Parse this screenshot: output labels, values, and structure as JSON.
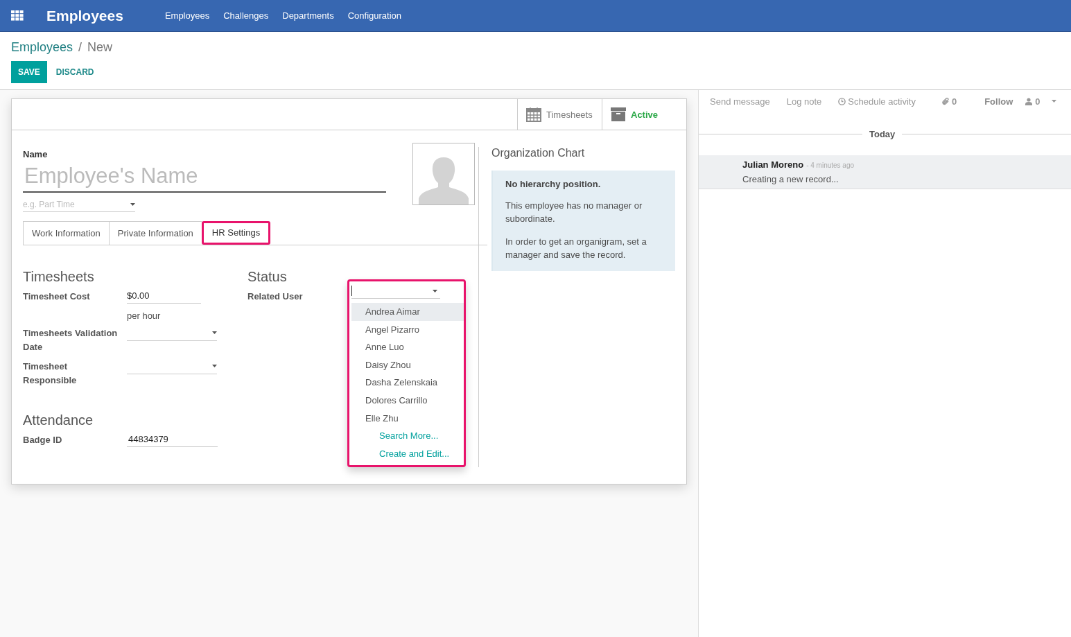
{
  "nav": {
    "app_title": "Employees",
    "menu": [
      "Employees",
      "Challenges",
      "Departments",
      "Configuration"
    ]
  },
  "breadcrumb": {
    "parent": "Employees",
    "separator": "/",
    "current": "New"
  },
  "buttons": {
    "save": "SAVE",
    "discard": "DISCARD"
  },
  "stat_buttons": [
    {
      "kind": "calendar",
      "label": "Timesheets",
      "active": false
    },
    {
      "kind": "archive",
      "label": "Active",
      "active": true
    }
  ],
  "form": {
    "name_label": "Name",
    "name_placeholder": "Employee's Name",
    "job_placeholder": "e.g. Part Time",
    "tabs": [
      {
        "label": "Work Information",
        "selected": false,
        "highlighted": false
      },
      {
        "label": "Private Information",
        "selected": false,
        "highlighted": false
      },
      {
        "label": "HR Settings",
        "selected": true,
        "highlighted": true
      }
    ],
    "timesheets": {
      "title": "Timesheets",
      "fields": [
        {
          "label": "Timesheet Cost",
          "kind": "input",
          "value": "$0.00",
          "note": "per hour"
        },
        {
          "label": "Timesheets Validation Date",
          "kind": "select"
        },
        {
          "label": "Timesheet Responsible",
          "kind": "select"
        }
      ]
    },
    "attendance": {
      "title": "Attendance",
      "fields": [
        {
          "label": "Badge ID",
          "kind": "input",
          "value": "44834379"
        }
      ]
    },
    "status": {
      "title": "Status",
      "related_user": {
        "label": "Related User",
        "highlighted": true,
        "options": [
          {
            "label": "Andrea Aimar",
            "kind": "option",
            "selected": true
          },
          {
            "label": "Angel Pizarro",
            "kind": "option",
            "selected": false
          },
          {
            "label": "Anne Luo",
            "kind": "option",
            "selected": false
          },
          {
            "label": "Daisy Zhou",
            "kind": "option",
            "selected": false
          },
          {
            "label": "Dasha Zelenskaia",
            "kind": "option",
            "selected": false
          },
          {
            "label": "Dolores Carrillo",
            "kind": "option",
            "selected": false
          },
          {
            "label": "Elle Zhu",
            "kind": "option",
            "selected": false
          },
          {
            "label": "Search More...",
            "kind": "action",
            "selected": false
          },
          {
            "label": "Create and Edit...",
            "kind": "action",
            "selected": false
          }
        ]
      }
    }
  },
  "org_chart": {
    "title": "Organization Chart",
    "heading": "No hierarchy position.",
    "paragraphs": [
      "This employee has no manager or subordinate.",
      "In order to get an organigram, set a manager and save the record."
    ]
  },
  "chatter": {
    "send_message": "Send message",
    "log_note": "Log note",
    "schedule_activity": "Schedule activity",
    "attachments": "0",
    "follow": "Follow",
    "followers": "0",
    "separator": "Today",
    "messages": [
      {
        "author": "Julian Moreno",
        "time": "- 4 minutes ago",
        "body": "Creating a new record..."
      }
    ]
  }
}
